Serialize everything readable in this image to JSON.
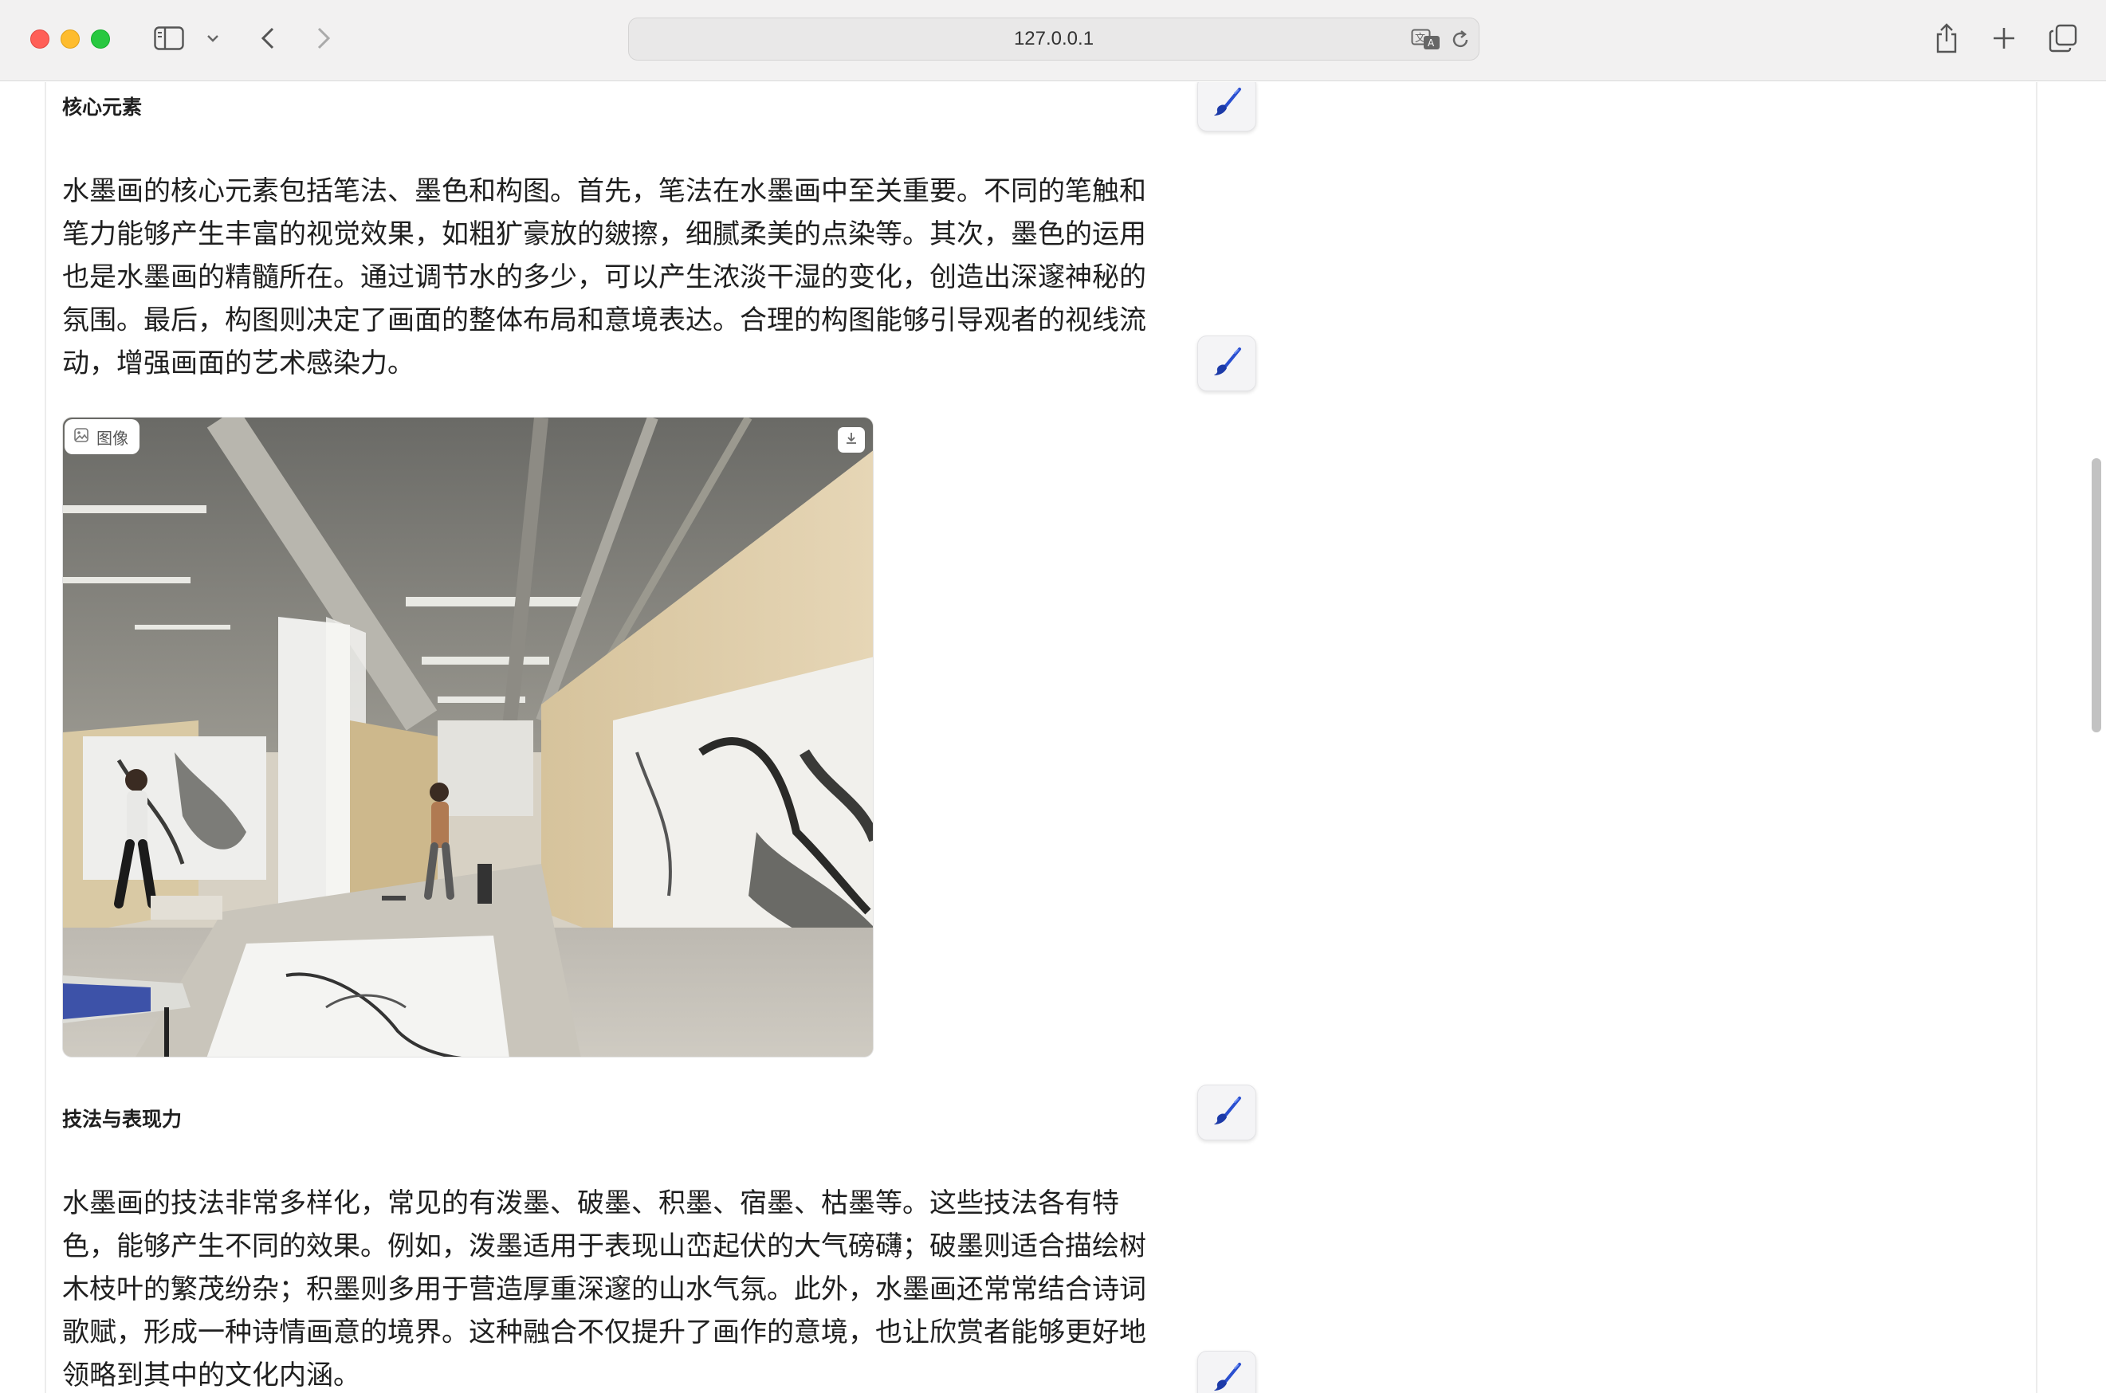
{
  "browser": {
    "url": "127.0.0.1"
  },
  "sections": [
    {
      "title": "核心元素",
      "paragraph": "水墨画的核心元素包括笔法、墨色和构图。首先，笔法在水墨画中至关重要。不同的笔触和笔力能够产生丰富的视觉效果，如粗犷豪放的皴擦，细腻柔美的点染等。其次，墨色的运用也是水墨画的精髓所在。通过调节水的多少，可以产生浓淡干湿的变化，创造出深邃神秘的氛围。最后，构图则决定了画面的整体布局和意境表达。合理的构图能够引导观者的视线流动，增强画面的艺术感染力。"
    },
    {
      "title": "技法与表现力",
      "paragraph": "水墨画的技法非常多样化，常见的有泼墨、破墨、积墨、宿墨、枯墨等。这些技法各有特色，能够产生不同的效果。例如，泼墨适用于表现山峦起伏的大气磅礴；破墨则适合描绘树木枝叶的繁茂纷杂；积墨则多用于营造厚重深邃的山水气氛。此外，水墨画还常常结合诗词歌赋，形成一种诗情画意的境界。这种融合不仅提升了画作的意境，也让欣赏者能够更好地领略到其中的文化内涵。"
    }
  ],
  "image_card": {
    "badge_label": "图像"
  },
  "icons": {
    "brush": "paintbrush-icon",
    "image": "image-icon",
    "download": "download-icon"
  }
}
